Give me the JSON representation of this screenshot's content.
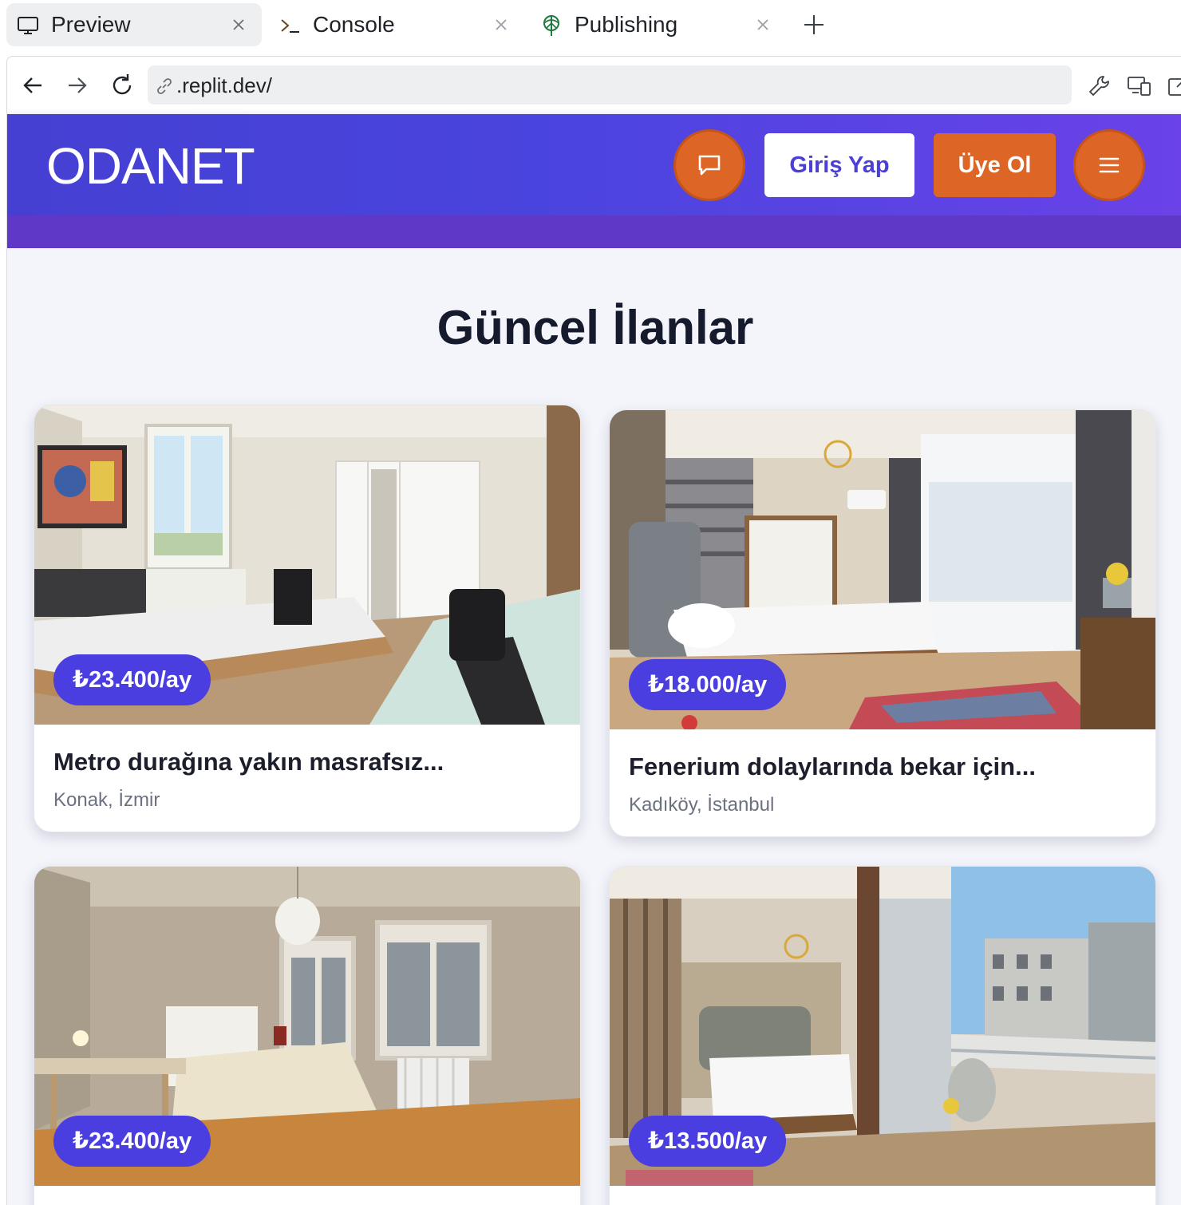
{
  "tabs": [
    {
      "label": "Preview",
      "icon": "monitor-icon",
      "active": true
    },
    {
      "label": "Console",
      "icon": "terminal-icon",
      "active": false
    },
    {
      "label": "Publishing",
      "icon": "publish-icon",
      "active": false
    }
  ],
  "browser": {
    "url": ".replit.dev/"
  },
  "site": {
    "logo": "ODANET",
    "login_label": "Giriş Yap",
    "signup_label": "Üye Ol",
    "accent_color": "#4a3ee0",
    "orange_color": "#dd6526"
  },
  "listings": {
    "heading": "Güncel İlanlar",
    "items": [
      {
        "price": "₺23.400/ay",
        "title": "Metro durağına yakın masrafsız...",
        "location": "Konak, İzmir"
      },
      {
        "price": "₺18.000/ay",
        "title": "Fenerium dolaylarında bekar için...",
        "location": "Kadıköy, İstanbul"
      },
      {
        "price": "₺23.400/ay",
        "title": "",
        "location": ""
      },
      {
        "price": "₺13.500/ay",
        "title": "",
        "location": ""
      }
    ]
  }
}
